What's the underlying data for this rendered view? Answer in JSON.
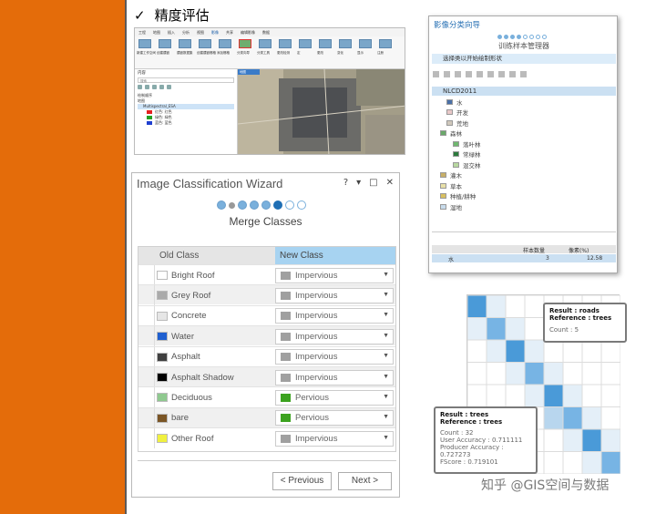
{
  "slide": {
    "check": "✓",
    "title": "精度评估"
  },
  "pro": {
    "tabs": [
      "工程",
      "地图",
      "插入",
      "分析",
      "视图",
      "影像",
      "共享",
      "编辑影像",
      "数据"
    ],
    "active_tab": "影像",
    "ribbon_buttons": [
      "新建工作空间",
      "创建镶嵌",
      "镶嵌数据集",
      "创建镶嵌栅格",
      "添加栅格",
      "分类向导",
      "分类工具",
      "更改检测",
      "定",
      "更改",
      "变化",
      "显示",
      "注册"
    ],
    "toc_title": "内容",
    "toc_search": "搜索",
    "toc_drawing_order": "绘制顺序",
    "toc_map": "地图",
    "toc_layer": "Multispectral_ESA",
    "legend": [
      {
        "label": "红色: 红色",
        "color": "#e52020"
      },
      {
        "label": "绿色: 绿色",
        "color": "#22a022"
      },
      {
        "label": "蓝色: 蓝色",
        "color": "#2040d0"
      }
    ],
    "map_tab": "地图"
  },
  "wizard": {
    "title": "Image Classification Wizard",
    "controls": [
      "?",
      "▾",
      "□",
      "✕"
    ],
    "step": "Merge Classes",
    "col_old": "Old Class",
    "col_new": "New Class",
    "rows": [
      {
        "old": "Bright Roof",
        "old_color": "#ffffff",
        "new": "Impervious",
        "new_color": "#a0a0a0"
      },
      {
        "old": "Grey Roof",
        "old_color": "#aaaaaa",
        "new": "Impervious",
        "new_color": "#a0a0a0"
      },
      {
        "old": "Concrete",
        "old_color": "#e6e6e6",
        "new": "Impervious",
        "new_color": "#a0a0a0"
      },
      {
        "old": "Water",
        "old_color": "#1f5fd0",
        "new": "Impervious",
        "new_color": "#a0a0a0"
      },
      {
        "old": "Asphalt",
        "old_color": "#404040",
        "new": "Impervious",
        "new_color": "#a0a0a0"
      },
      {
        "old": "Asphalt Shadow",
        "old_color": "#000000",
        "new": "Impervious",
        "new_color": "#a0a0a0"
      },
      {
        "old": "Deciduous",
        "old_color": "#8fc98f",
        "new": "Pervious",
        "new_color": "#3ca21f"
      },
      {
        "old": "bare",
        "old_color": "#7a5525",
        "new": "Pervious",
        "new_color": "#3ca21f"
      },
      {
        "old": "Other Roof",
        "old_color": "#f0f040",
        "new": "Impervious",
        "new_color": "#a0a0a0"
      }
    ],
    "prev_label": "< Previous",
    "next_label": "Next >"
  },
  "tsm": {
    "title": "影像分类向导",
    "subtitle": "训练样本管理器",
    "info": "选择类以开始绘制形状",
    "root": "NLCD2011",
    "classes": [
      {
        "label": "水",
        "color": "#4a70a8",
        "indent": 1
      },
      {
        "label": "开发",
        "color": "#e8c8c8",
        "indent": 1
      },
      {
        "label": "荒地",
        "color": "#d0c8bc",
        "indent": 1
      },
      {
        "label": "森林",
        "color": "#6aa86a",
        "indent": 0
      },
      {
        "label": "落叶林",
        "color": "#70b870",
        "indent": 2
      },
      {
        "label": "常绿林",
        "color": "#2c7a3c",
        "indent": 2
      },
      {
        "label": "混交林",
        "color": "#b8d8a0",
        "indent": 2
      },
      {
        "label": "灌木",
        "color": "#c8b068",
        "indent": 0
      },
      {
        "label": "草本",
        "color": "#e8e0a8",
        "indent": 0
      },
      {
        "label": "种植/耕种",
        "color": "#d8c060",
        "indent": 0
      },
      {
        "label": "湿地",
        "color": "#c8dcec",
        "indent": 0
      }
    ],
    "col_samples": "样本数量",
    "col_pixels": "像素(%)",
    "row_name": "水",
    "row_samples": "3",
    "row_pixels": "12.58"
  },
  "tip_roads": {
    "result": "Result : roads",
    "reference": "Reference : trees",
    "count": "Count : 5"
  },
  "tip_trees": {
    "result": "Result : trees",
    "reference": "Reference : trees",
    "count": "Count : 32",
    "ua": "User Accuracy : 0.711111",
    "pa": "Producer Accuracy : 0.727273",
    "fs": "FScore : 0.719101"
  },
  "watermark": "知乎 @GIS空间与数据"
}
